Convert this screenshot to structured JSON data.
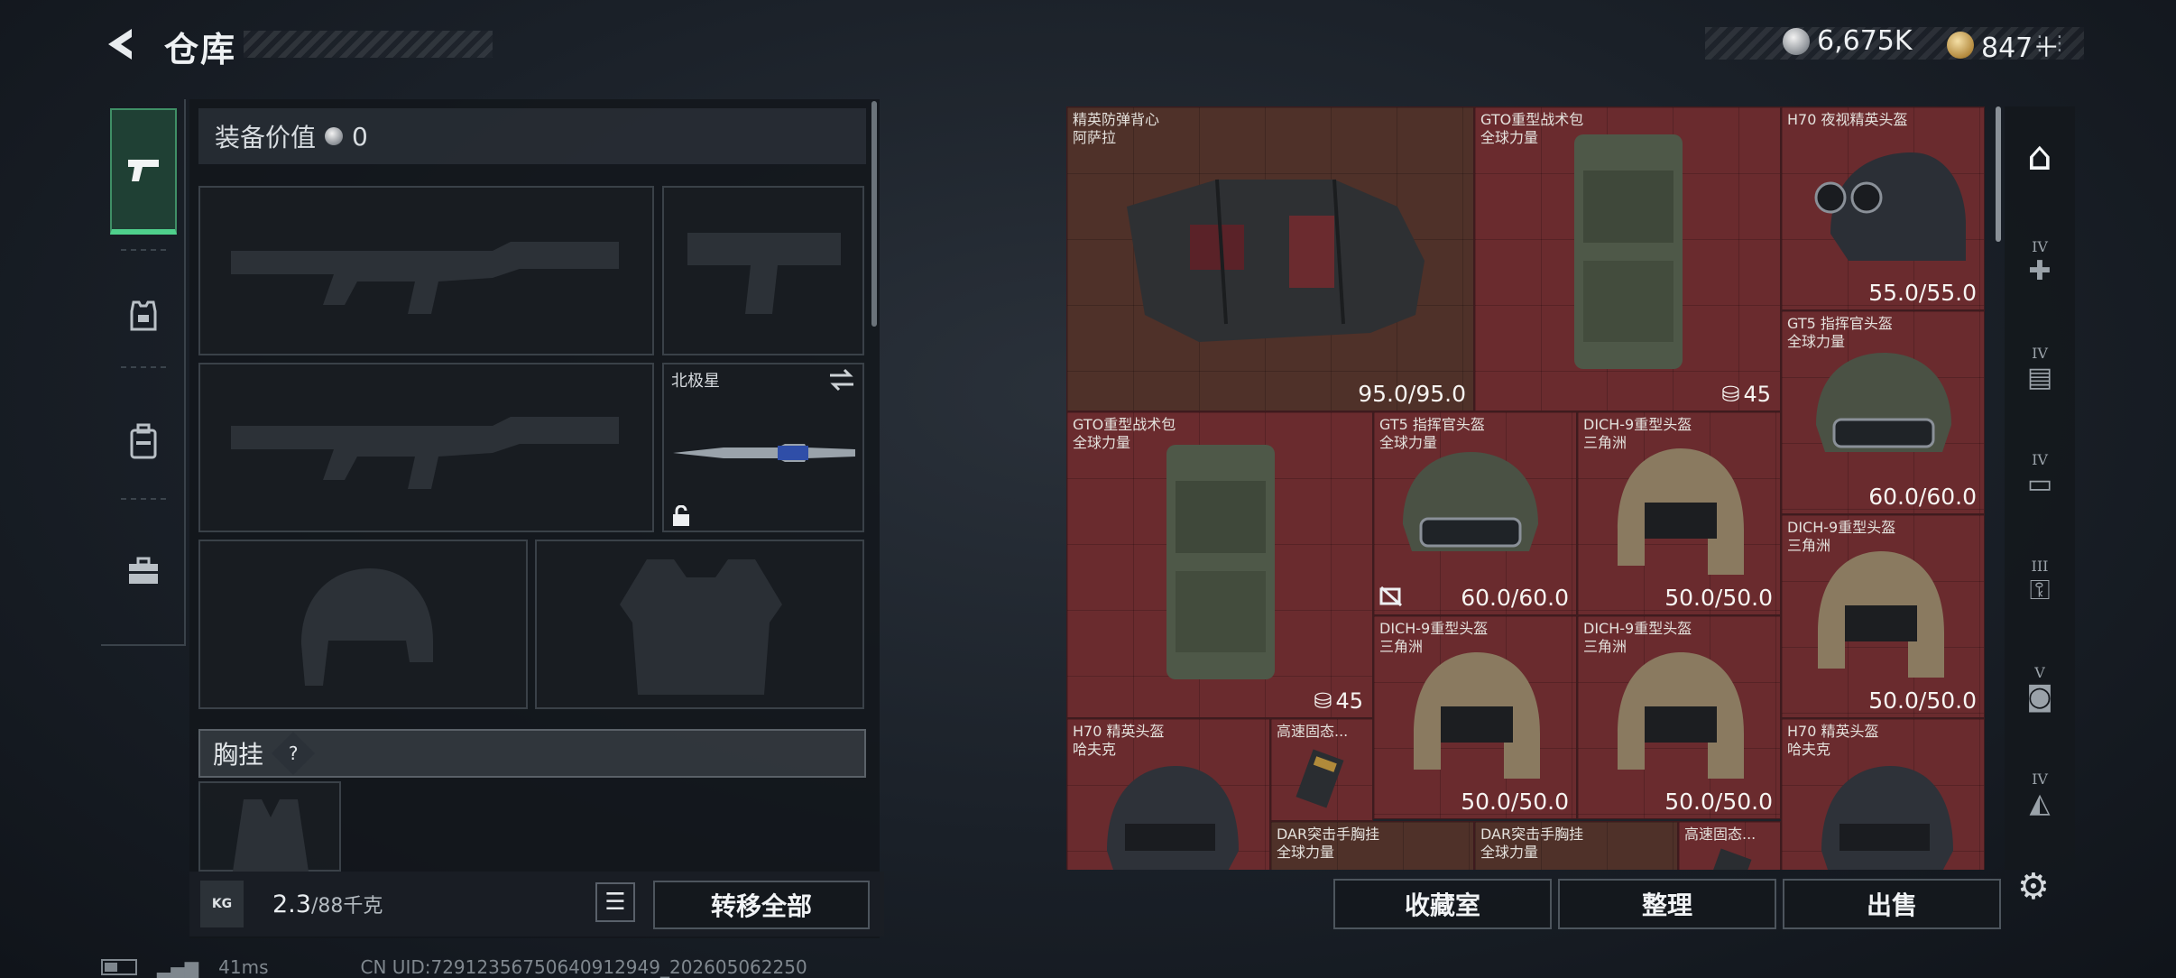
{
  "header": {
    "title": "仓库",
    "silver_amount": "6,675K",
    "gold_amount": "847＋"
  },
  "tabs": [
    {
      "name": "weapons",
      "icon": "pistol-icon",
      "active": true
    },
    {
      "name": "gear",
      "icon": "armor-icon",
      "active": false
    },
    {
      "name": "backpack",
      "icon": "backpack-icon",
      "active": false
    },
    {
      "name": "supplies",
      "icon": "toolbox-icon",
      "active": false
    }
  ],
  "equipment": {
    "value_label": "装备价值",
    "value": "0",
    "melee_slot": {
      "name": "北极星"
    },
    "chest_rig_label": "胸挂",
    "help_label": "?",
    "weight": "2.3",
    "weight_cap": "/88千克",
    "kg_label": "KG",
    "transfer_all": "转移全部"
  },
  "storage": {
    "items": [
      {
        "name": "精英防弹背心",
        "brand": "阿萨拉",
        "durability": "95.0/95.0"
      },
      {
        "name": "GTO重型战术包",
        "brand": "全球力量",
        "count": "45"
      },
      {
        "name": "H70 夜视精英头盔",
        "brand": "",
        "durability": "55.0/55.0"
      },
      {
        "name": "GT5 指挥官头盔",
        "brand": "全球力量",
        "durability": "60.0/60.0"
      },
      {
        "name": "GTO重型战术包",
        "brand": "全球力量",
        "count": "45"
      },
      {
        "name": "GT5 指挥官头盔",
        "brand": "全球力量",
        "durability": "60.0/60.0"
      },
      {
        "name": "DICH-9重型头盔",
        "brand": "三角洲",
        "durability": "50.0/50.0"
      },
      {
        "name": "DICH-9重型头盔",
        "brand": "三角洲",
        "durability": "50.0/50.0"
      },
      {
        "name": "DICH-9重型头盔",
        "brand": "三角洲",
        "durability": "50.0/50.0"
      },
      {
        "name": "DICH-9重型头盔",
        "brand": "三角洲",
        "durability": "50.0/50.0"
      },
      {
        "name": "H70 精英头盔",
        "brand": "哈夫克",
        "durability": ""
      },
      {
        "name": "高速固态...",
        "brand": "",
        "durability": ""
      },
      {
        "name": "H70 精英头盔",
        "brand": "哈夫克",
        "durability": ""
      },
      {
        "name": "DAR突击手胸挂",
        "brand": "全球力量",
        "durability": ""
      },
      {
        "name": "DAR突击手胸挂",
        "brand": "全球力量",
        "durability": ""
      },
      {
        "name": "高速固态...",
        "brand": "",
        "durability": ""
      }
    ]
  },
  "categories": [
    {
      "tier": "",
      "icon": "all-items-icon",
      "active": true
    },
    {
      "tier": "IV",
      "icon": "medkit-icon"
    },
    {
      "tier": "IV",
      "icon": "document-icon"
    },
    {
      "tier": "IV",
      "icon": "tool-icon"
    },
    {
      "tier": "III",
      "icon": "key-icon"
    },
    {
      "tier": "V",
      "icon": "device-icon"
    },
    {
      "tier": "IV",
      "icon": "material-icon"
    }
  ],
  "actions": {
    "collection_room": "收藏室",
    "organize": "整理",
    "sell": "出售"
  },
  "status": {
    "ping": "41ms",
    "uid": "CN UID:72912356750640912949_202605062250"
  },
  "colors": {
    "cell_red": "#6a2b2e",
    "cell_brown": "#4f3129",
    "active_tab": "#4fd08c"
  }
}
